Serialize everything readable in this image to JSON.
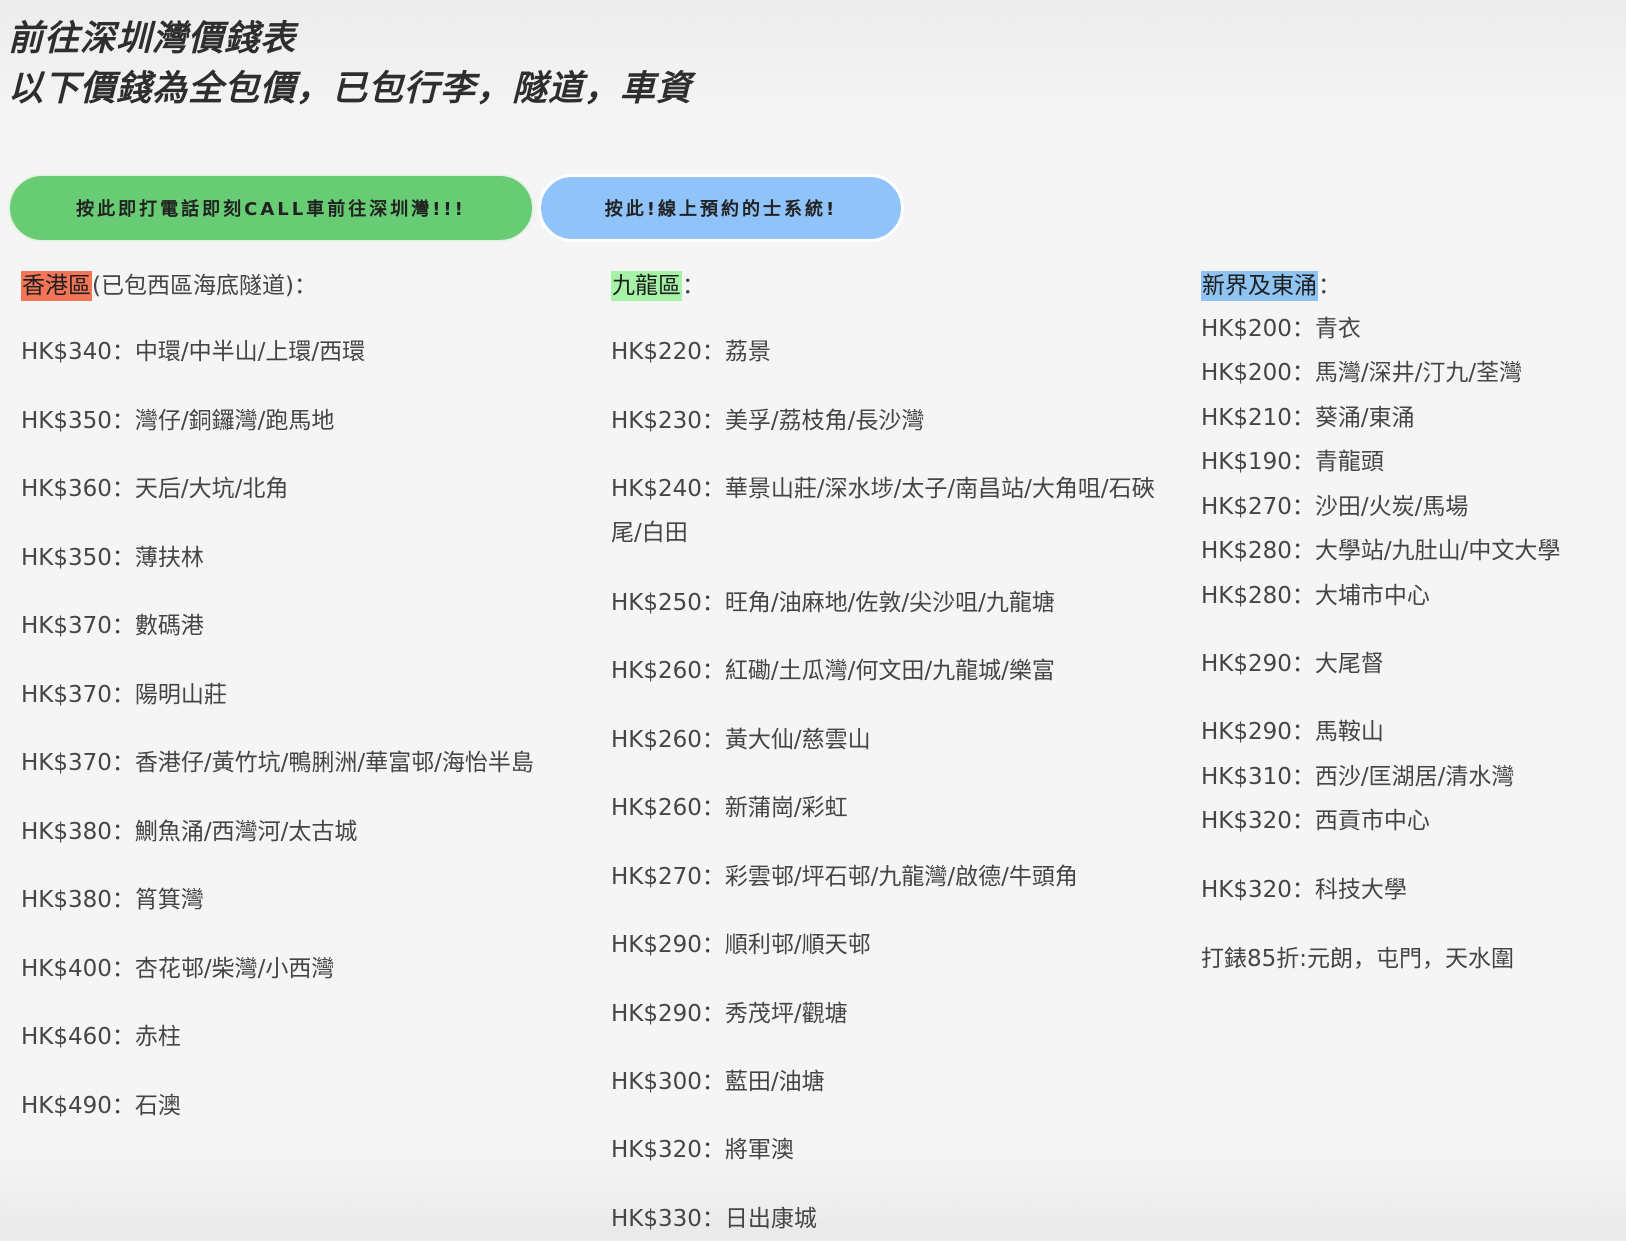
{
  "header": {
    "title_line1": "前往深圳灣價錢表",
    "title_line2": "以下價錢為全包價，已包行李，隧道，車資"
  },
  "buttons": {
    "call_label": "按此即打電話即刻CALL車前往深圳灣!!!",
    "book_label": "按此!線上預約的士系統!"
  },
  "hk_island": {
    "tag": "香港區",
    "note": "(已包西區海底隧道)：",
    "rows": [
      {
        "price": "HK$340",
        "areas": "中環/中半山/上環/西環"
      },
      {
        "price": "HK$350",
        "areas": "灣仔/銅鑼灣/跑馬地"
      },
      {
        "price": "HK$360",
        "areas": "天后/大坑/北角"
      },
      {
        "price": "HK$350",
        "areas": "薄扶林"
      },
      {
        "price": "HK$370",
        "areas": "數碼港"
      },
      {
        "price": "HK$370",
        "areas": "陽明山莊"
      },
      {
        "price": "HK$370",
        "areas": "香港仔/黃竹坑/鴨脷洲/華富邨/海怡半島"
      },
      {
        "price": "HK$380",
        "areas": "鰂魚涌/西灣河/太古城"
      },
      {
        "price": "HK$380",
        "areas": "筲箕灣"
      },
      {
        "price": "HK$400",
        "areas": "杏花邨/柴灣/小西灣"
      },
      {
        "price": "HK$460",
        "areas": "赤柱"
      },
      {
        "price": "HK$490",
        "areas": "石澳"
      }
    ]
  },
  "kowloon": {
    "tag": "九龍區",
    "note": "：",
    "rows": [
      {
        "price": "HK$220",
        "areas": "荔景"
      },
      {
        "price": "HK$230",
        "areas": "美孚/荔枝角/長沙灣"
      },
      {
        "price": "HK$240",
        "areas": "華景山莊/深水埗/太子/南昌站/大角咀/石硤尾/白田"
      },
      {
        "price": "HK$250",
        "areas": "旺角/油麻地/佐敦/尖沙咀/九龍塘"
      },
      {
        "price": "HK$260",
        "areas": "紅磡/土瓜灣/何文田/九龍城/樂富"
      },
      {
        "price": "HK$260",
        "areas": "黃大仙/慈雲山"
      },
      {
        "price": "HK$260",
        "areas": "新蒲崗/彩虹"
      },
      {
        "price": "HK$270",
        "areas": "彩雲邨/坪石邨/九龍灣/啟德/牛頭角"
      },
      {
        "price": "HK$290",
        "areas": "順利邨/順天邨"
      },
      {
        "price": "HK$290",
        "areas": "秀茂坪/觀塘"
      },
      {
        "price": "HK$300",
        "areas": "藍田/油塘"
      },
      {
        "price": "HK$320",
        "areas": "將軍澳"
      },
      {
        "price": "HK$330",
        "areas": "日出康城"
      }
    ]
  },
  "new_territories": {
    "tag": "新界及東涌",
    "note": "：",
    "rows": [
      {
        "price": "HK$200",
        "areas": "青衣"
      },
      {
        "price": "HK$200",
        "areas": "馬灣/深井/汀九/荃灣"
      },
      {
        "price": "HK$210",
        "areas": "葵涌/東涌"
      },
      {
        "price": "HK$190",
        "areas": "青龍頭"
      },
      {
        "price": "HK$270",
        "areas": "沙田/火炭/馬場"
      },
      {
        "price": "HK$280",
        "areas": "大學站/九肚山/中文大學"
      },
      {
        "price": "HK$280",
        "areas": "大埔市中心"
      },
      {
        "price": "HK$290",
        "areas": "大尾督"
      },
      {
        "price": "HK$290",
        "areas": "馬鞍山"
      },
      {
        "price": "HK$310",
        "areas": "西沙/匡湖居/清水灣"
      },
      {
        "price": "HK$320",
        "areas": "西貢市中心"
      },
      {
        "price": "HK$320",
        "areas": "科技大學"
      }
    ],
    "discount_note": "打錶85折:元朗，屯門，天水圍"
  },
  "separator": "："
}
